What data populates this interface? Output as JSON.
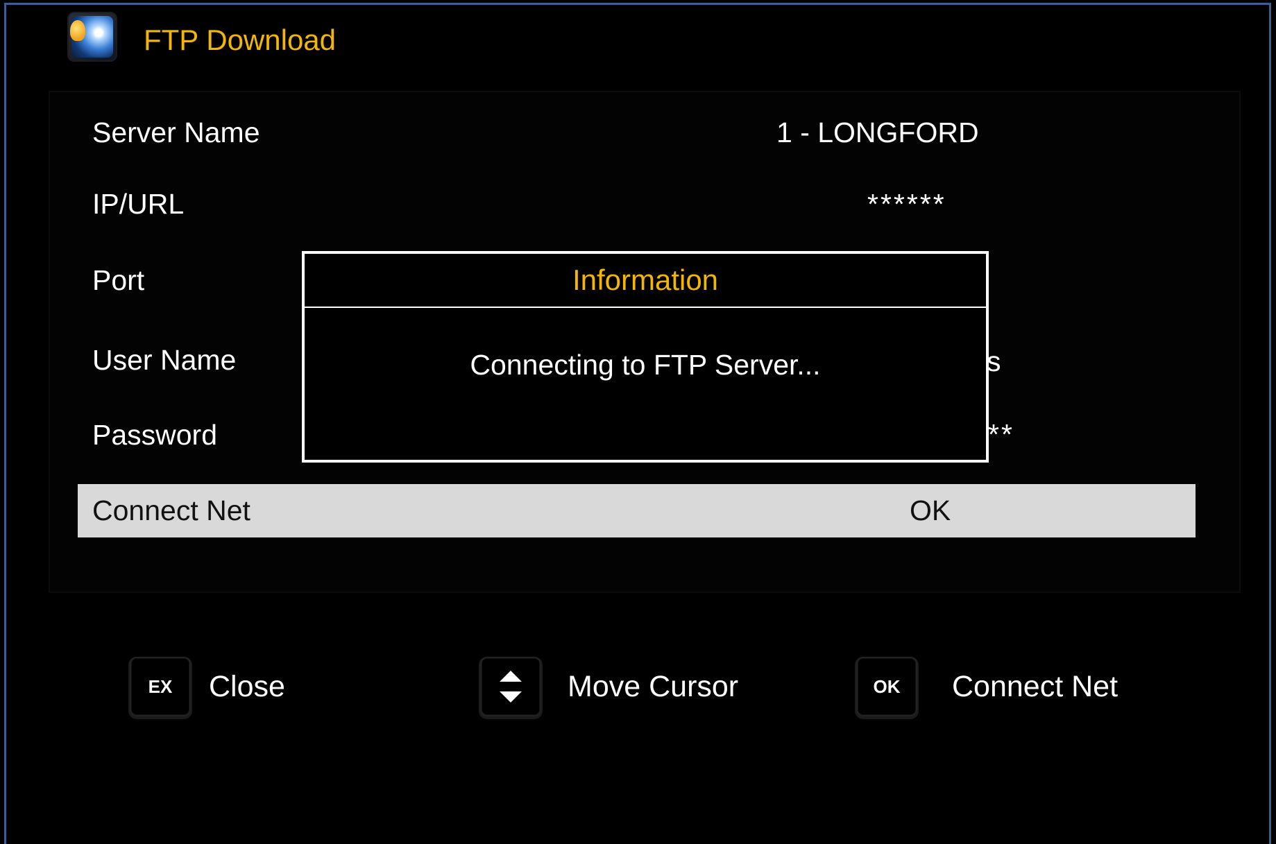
{
  "window": {
    "title": "FTP Download",
    "icon": "ftp-app-icon"
  },
  "fields": {
    "server_name": {
      "label": "Server Name",
      "value": "1 - LONGFORD"
    },
    "ip_url": {
      "label": "IP/URL",
      "value": "******"
    },
    "port": {
      "label": "Port"
    },
    "user_name": {
      "label": "User Name",
      "value_fragment": "s"
    },
    "password": {
      "label": "Password",
      "value_fragment": "**"
    },
    "connect_net": {
      "label": "Connect Net",
      "value": "OK"
    }
  },
  "dialog": {
    "title": "Information",
    "message": "Connecting to FTP Server..."
  },
  "hints": [
    {
      "key": "EX",
      "label": "Close"
    },
    {
      "key_icon": "up-down-arrows-icon",
      "label": "Move Cursor"
    },
    {
      "key": "OK",
      "label": "Connect Net"
    }
  ],
  "colors": {
    "accent": "#f2b705",
    "background": "#000000",
    "selection": "#d9d9d9",
    "frame_border": "#3d5f91"
  }
}
